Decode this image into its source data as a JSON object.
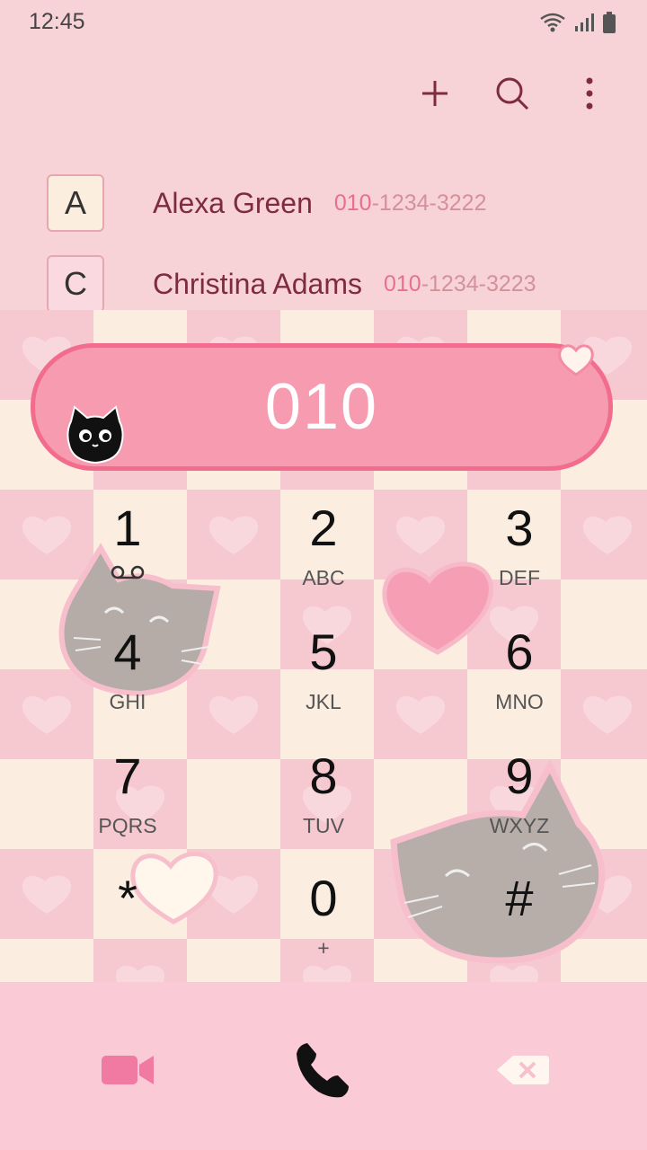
{
  "status_bar": {
    "time": "12:45"
  },
  "contacts": [
    {
      "letter": "A",
      "name": "Alexa Green",
      "number_match": "010",
      "number_rest": "-1234-3222"
    },
    {
      "letter": "C",
      "name": "Christina Adams",
      "number_match": "010",
      "number_rest": "-1234-3223"
    }
  ],
  "display": {
    "digits": "010"
  },
  "keypad": [
    {
      "digit": "1",
      "letters": ""
    },
    {
      "digit": "2",
      "letters": "ABC"
    },
    {
      "digit": "3",
      "letters": "DEF"
    },
    {
      "digit": "4",
      "letters": "GHI"
    },
    {
      "digit": "5",
      "letters": "JKL"
    },
    {
      "digit": "6",
      "letters": "MNO"
    },
    {
      "digit": "7",
      "letters": "PQRS"
    },
    {
      "digit": "8",
      "letters": "TUV"
    },
    {
      "digit": "9",
      "letters": "WXYZ"
    },
    {
      "digit": "*",
      "letters": ""
    },
    {
      "digit": "0",
      "letters": "+"
    },
    {
      "digit": "#",
      "letters": ""
    }
  ],
  "icons": {
    "toolbar": [
      "add-icon",
      "search-icon",
      "more-vert-icon"
    ],
    "bottom": [
      "video-call-icon",
      "phone-call-icon",
      "backspace-icon"
    ]
  },
  "colors": {
    "accent": "#f26d8d",
    "display_fill": "#f69bb0",
    "contact_name": "#7e2c3d",
    "number_match": "#e7708c"
  }
}
